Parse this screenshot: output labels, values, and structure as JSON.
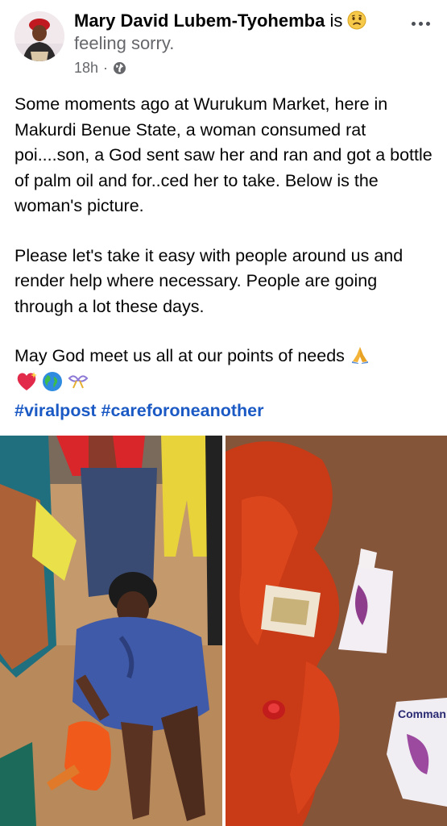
{
  "post": {
    "author": "Mary David Lubem-Tyohemba",
    "is_word": "is",
    "feeling_icon": "sad-face-emoji",
    "feeling": "feeling sorry.",
    "time": "18h",
    "separator": "·",
    "audience_icon": "globe-icon",
    "menu_icon": "more-dots-icon"
  },
  "body": {
    "paragraph1": "Some moments ago at Wurukum Market, here in Makurdi Benue State, a woman consumed rat poi....son,  a God sent saw her and ran and got a bottle of palm oil and for..ced her to take. Below is the woman's picture.",
    "paragraph2": "Please let's take it easy with people around us and render help where necessary. People are going through a lot these days.",
    "paragraph3": "May God meet us all at our points of needs",
    "emojis": [
      "folded-hands",
      "sparkling-heart",
      "globe",
      "ribbon"
    ],
    "hashtags": "#viralpost #careforoneanother"
  },
  "photos": {
    "left_label": "woman-seated-market-photo",
    "right_label": "spilled-palm-oil-packets-photo",
    "packet_text": "Comman"
  },
  "colors": {
    "hashtag": "#1b5ac4",
    "muted": "#65676b",
    "text": "#050505"
  }
}
